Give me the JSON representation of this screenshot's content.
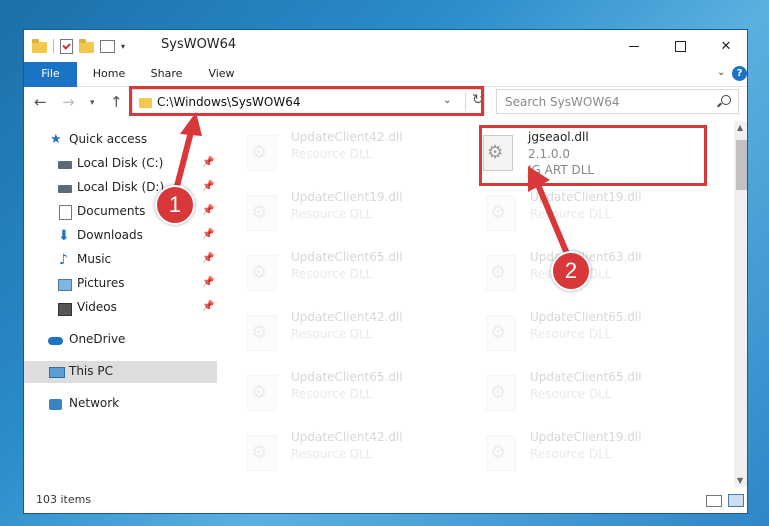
{
  "window": {
    "title": "SysWOW64",
    "buttons": {
      "minimize": "—",
      "maximize": "□",
      "close": "✕"
    }
  },
  "ribbon": {
    "tabs": [
      {
        "label": "File"
      },
      {
        "label": "Home"
      },
      {
        "label": "Share"
      },
      {
        "label": "View"
      }
    ],
    "help": "?"
  },
  "navigation": {
    "address": "C:\\Windows\\SysWOW64",
    "search_placeholder": "Search SysWOW64"
  },
  "sidebar": {
    "items": [
      {
        "label": "Quick access",
        "icon": "star-icon"
      },
      {
        "label": "Local Disk (C:)",
        "icon": "disk-icon",
        "pinned": true
      },
      {
        "label": "Local Disk (D:)",
        "icon": "disk-icon",
        "pinned": true
      },
      {
        "label": "Documents",
        "icon": "documents-icon",
        "pinned": true
      },
      {
        "label": "Downloads",
        "icon": "downloads-icon",
        "pinned": true
      },
      {
        "label": "Music",
        "icon": "music-icon",
        "pinned": true
      },
      {
        "label": "Pictures",
        "icon": "pictures-icon",
        "pinned": true
      },
      {
        "label": "Videos",
        "icon": "videos-icon",
        "pinned": true
      },
      {
        "label": "OneDrive",
        "icon": "onedrive-icon"
      },
      {
        "label": "This PC",
        "icon": "pc-icon",
        "selected": true
      },
      {
        "label": "Network",
        "icon": "network-icon"
      }
    ]
  },
  "files": {
    "highlighted": {
      "name": "jgseaol.dll",
      "version": "2.1.0.0",
      "type": "JG ART DLL"
    },
    "left_column": [
      {
        "name": "UpdateClient42.dll",
        "type": "Resource DLL"
      },
      {
        "name": "UpdateClient19.dll",
        "type": "Resource DLL"
      },
      {
        "name": "UpdateClient65.dll",
        "type": "Resource DLL"
      },
      {
        "name": "UpdateClient42.dll",
        "type": "Resource DLL"
      },
      {
        "name": "UpdateClient65.dll",
        "type": "Resource DLL"
      },
      {
        "name": "UpdateClient42.dll",
        "type": "Resource DLL"
      }
    ],
    "right_column": [
      {
        "name": "UpdateClient19.dll",
        "type": "Resource DLL"
      },
      {
        "name": "UpdateClient63.dll",
        "type": "Resource DLL"
      },
      {
        "name": "UpdateClient65.dll",
        "type": "Resource DLL"
      },
      {
        "name": "UpdateClient65.dll",
        "type": "Resource DLL"
      },
      {
        "name": "UpdateClient19.dll",
        "type": "Resource DLL"
      }
    ]
  },
  "status": {
    "item_count": "103 items"
  },
  "annotations": {
    "callout1": "1",
    "callout2": "2",
    "highlight_color": "#d9383a"
  }
}
